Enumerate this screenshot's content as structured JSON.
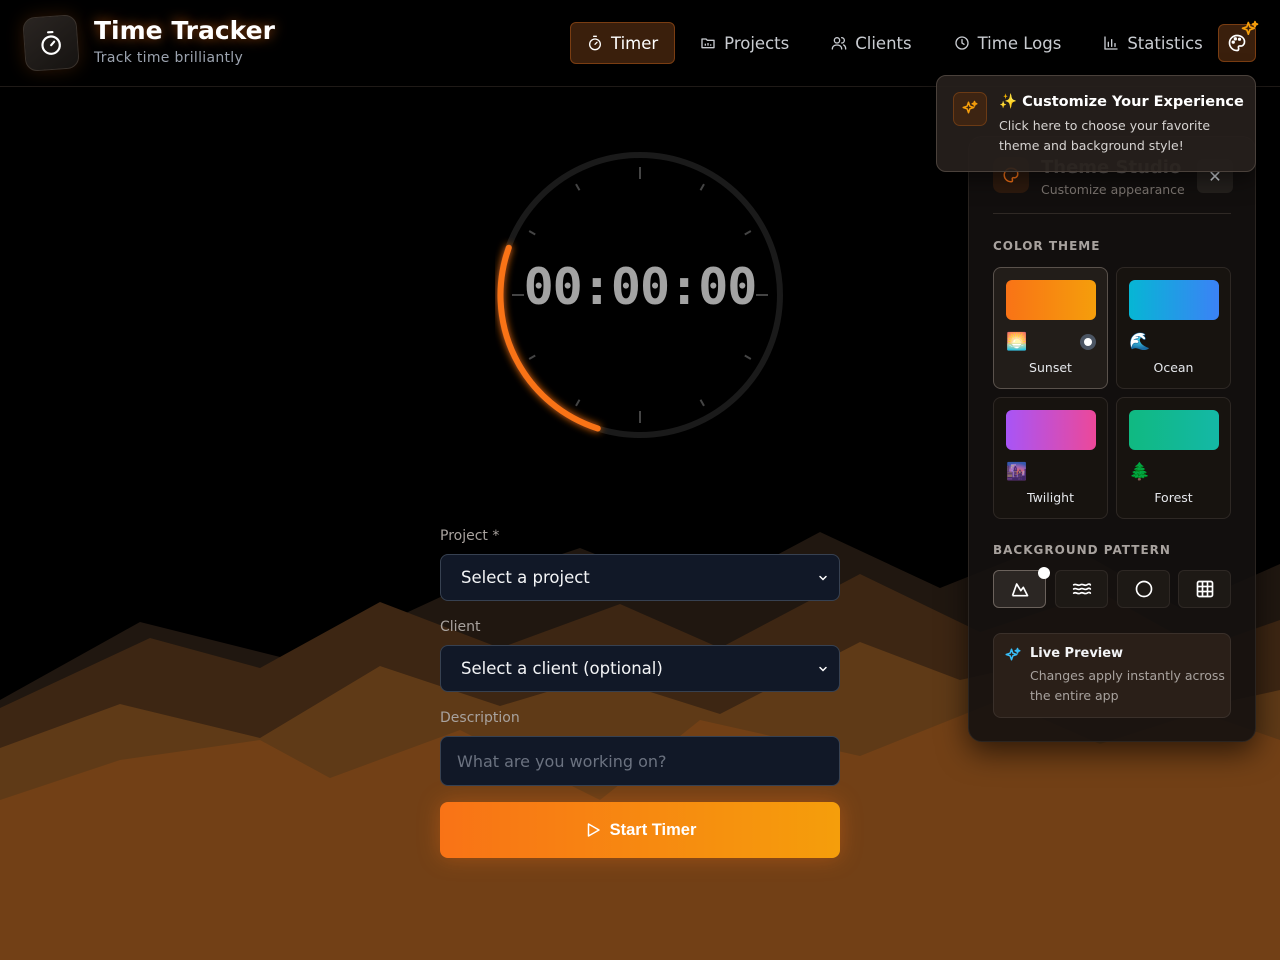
{
  "header": {
    "app_title": "Time Tracker",
    "app_subtitle": "Track time brilliantly",
    "logo_icon": "stopwatch-icon"
  },
  "nav": {
    "items": [
      {
        "label": "Timer",
        "icon": "stopwatch-icon",
        "active": true
      },
      {
        "label": "Projects",
        "icon": "folder-icon",
        "active": false
      },
      {
        "label": "Clients",
        "icon": "users-icon",
        "active": false
      },
      {
        "label": "Time Logs",
        "icon": "clock-icon",
        "active": false
      },
      {
        "label": "Statistics",
        "icon": "bar-chart-icon",
        "active": false
      }
    ],
    "theme_button_icon": "palette-icon"
  },
  "timer": {
    "display": "00:00:00"
  },
  "form": {
    "project_label": "Project *",
    "project_value": "Select a project",
    "client_label": "Client",
    "client_value": "Select a client (optional)",
    "description_label": "Description",
    "description_placeholder": "What are you working on?",
    "start_label": "Start Timer"
  },
  "tooltip": {
    "title": "✨ Customize Your Experience",
    "text": "Click here to choose your favorite theme and background style!"
  },
  "theme_panel": {
    "title": "Theme Studio",
    "subtitle": "Customize appearance",
    "close_label": "✕",
    "color_theme_heading": "COLOR THEME",
    "themes": [
      {
        "name": "Sunset",
        "emoji": "🌅",
        "selected": true,
        "gradient": [
          "#f97316",
          "#f59e0b"
        ]
      },
      {
        "name": "Ocean",
        "emoji": "🌊",
        "selected": false,
        "gradient": [
          "#06b6d4",
          "#3b82f6"
        ]
      },
      {
        "name": "Twilight",
        "emoji": "🌆",
        "selected": false,
        "gradient": [
          "#a855f7",
          "#ec4899"
        ]
      },
      {
        "name": "Forest",
        "emoji": "🌲",
        "selected": false,
        "gradient": [
          "#10b981",
          "#14b8a6"
        ]
      }
    ],
    "background_pattern_heading": "BACKGROUND PATTERN",
    "patterns": [
      {
        "icon": "mountain-icon",
        "selected": true
      },
      {
        "icon": "waves-icon",
        "selected": false
      },
      {
        "icon": "circle-icon",
        "selected": false
      },
      {
        "icon": "grid-icon",
        "selected": false
      }
    ],
    "live_preview_title": "Live Preview",
    "live_preview_text": "Changes apply instantly across the entire app"
  },
  "colors": {
    "accent": "#f97316",
    "accent_secondary": "#f59e0b",
    "background": "#000000",
    "input_bg": "#111827"
  }
}
